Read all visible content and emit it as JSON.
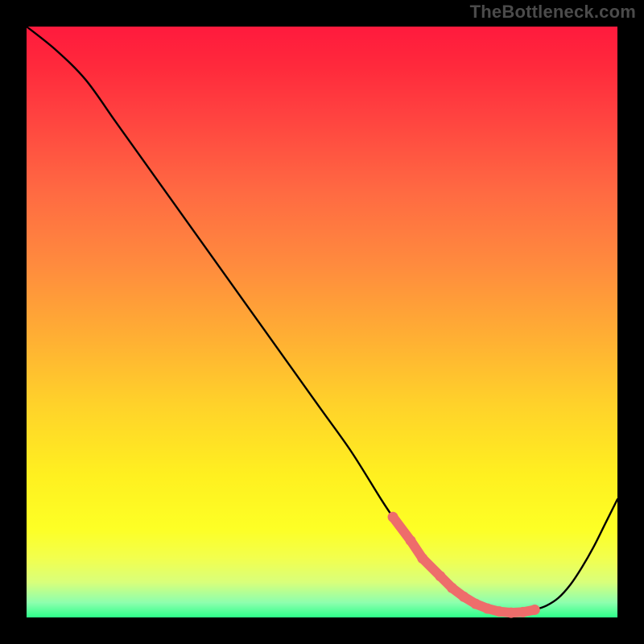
{
  "watermark": "TheBottleneck.com",
  "colors": {
    "background": "#000000",
    "watermark": "#4b4b4b",
    "curve": "#000000",
    "marker": "#ee6d6b"
  },
  "chart_data": {
    "type": "line",
    "title": "",
    "xlabel": "",
    "ylabel": "",
    "xlim": [
      0,
      100
    ],
    "ylim": [
      0,
      100
    ],
    "x": [
      0,
      5,
      10,
      15,
      20,
      25,
      30,
      35,
      40,
      45,
      50,
      55,
      60,
      62,
      65,
      67,
      70,
      72,
      74,
      76,
      78,
      80,
      82,
      84,
      86,
      88,
      90,
      92,
      94,
      96,
      98,
      100
    ],
    "values": [
      100,
      96,
      91,
      84,
      77,
      70,
      63,
      56,
      49,
      42,
      35,
      28,
      20,
      17,
      13,
      10,
      7,
      5,
      3.5,
      2.3,
      1.5,
      1.0,
      0.8,
      0.9,
      1.3,
      2.0,
      3.3,
      5.5,
      8.5,
      12,
      16,
      20
    ],
    "markers": {
      "x": [
        62,
        65,
        67,
        70,
        72,
        74,
        76,
        78,
        80,
        82,
        84,
        86
      ],
      "values": [
        17,
        13,
        10,
        7,
        5,
        3.5,
        2.3,
        1.5,
        1.0,
        0.8,
        0.9,
        1.3
      ]
    }
  }
}
